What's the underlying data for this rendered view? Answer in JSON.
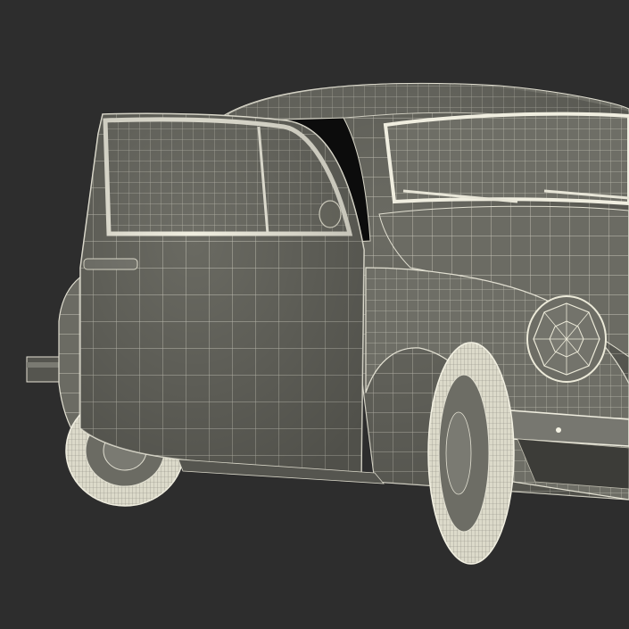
{
  "scene": {
    "subject": "wireframe-render-of-classic-beetle-car-with-open-door",
    "background_color": "#2d2d2d",
    "body_color": "#6b6b63",
    "wire_color": "#e6e4d6",
    "tire_color": "#d9d7c6",
    "shadow_color": "#3a3a36"
  }
}
